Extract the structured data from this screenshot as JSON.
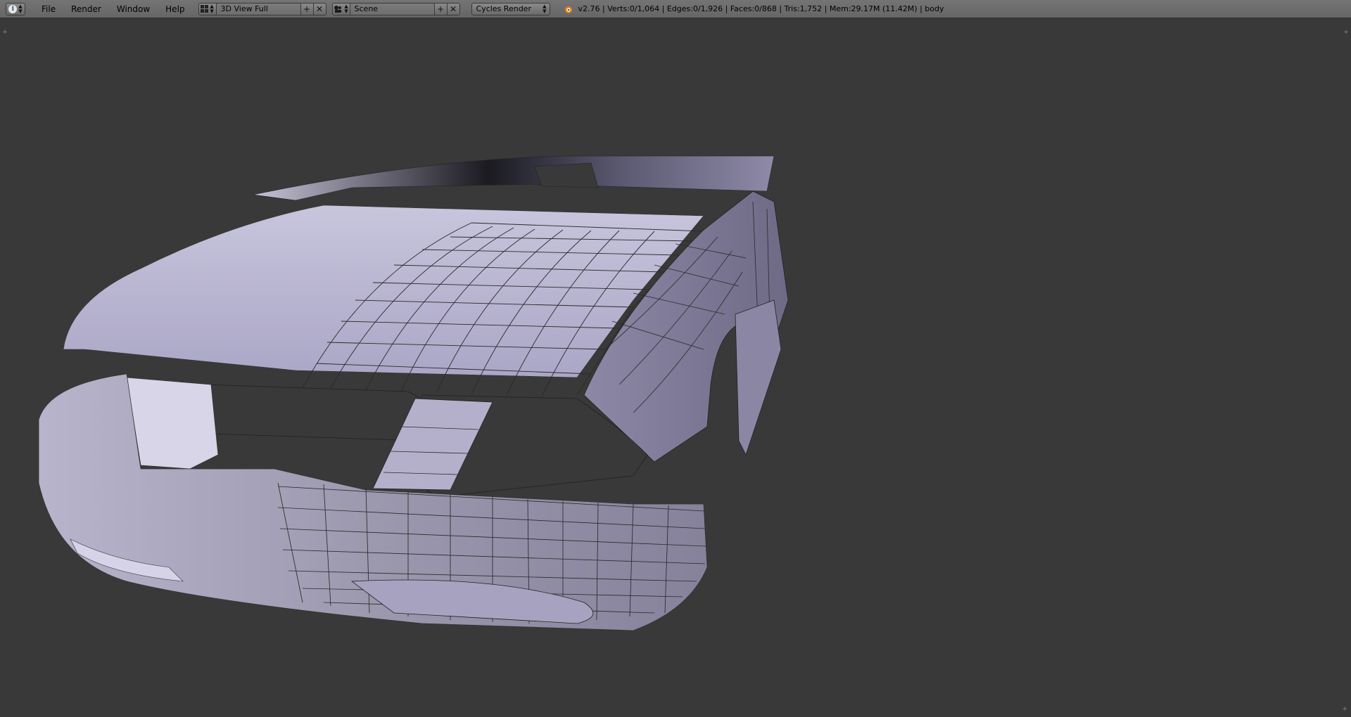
{
  "header": {
    "editor_type_icon": "info-icon",
    "menu": [
      "File",
      "Render",
      "Window",
      "Help"
    ],
    "screen_layout": {
      "icon": "screen-layout-icon",
      "value": "3D View Full"
    },
    "scene": {
      "icon": "scene-icon",
      "value": "Scene"
    },
    "render_engine": "Cycles Render",
    "stats": "v2.76 | Verts:0/1,064 | Edges:0/1,926 | Faces:0/868 | Tris:1,752 | Mem:29.17M (11.42M) | body"
  },
  "viewport": {
    "background_color": "#393939",
    "object_name": "body",
    "mesh_color": "#b4b0d0"
  }
}
